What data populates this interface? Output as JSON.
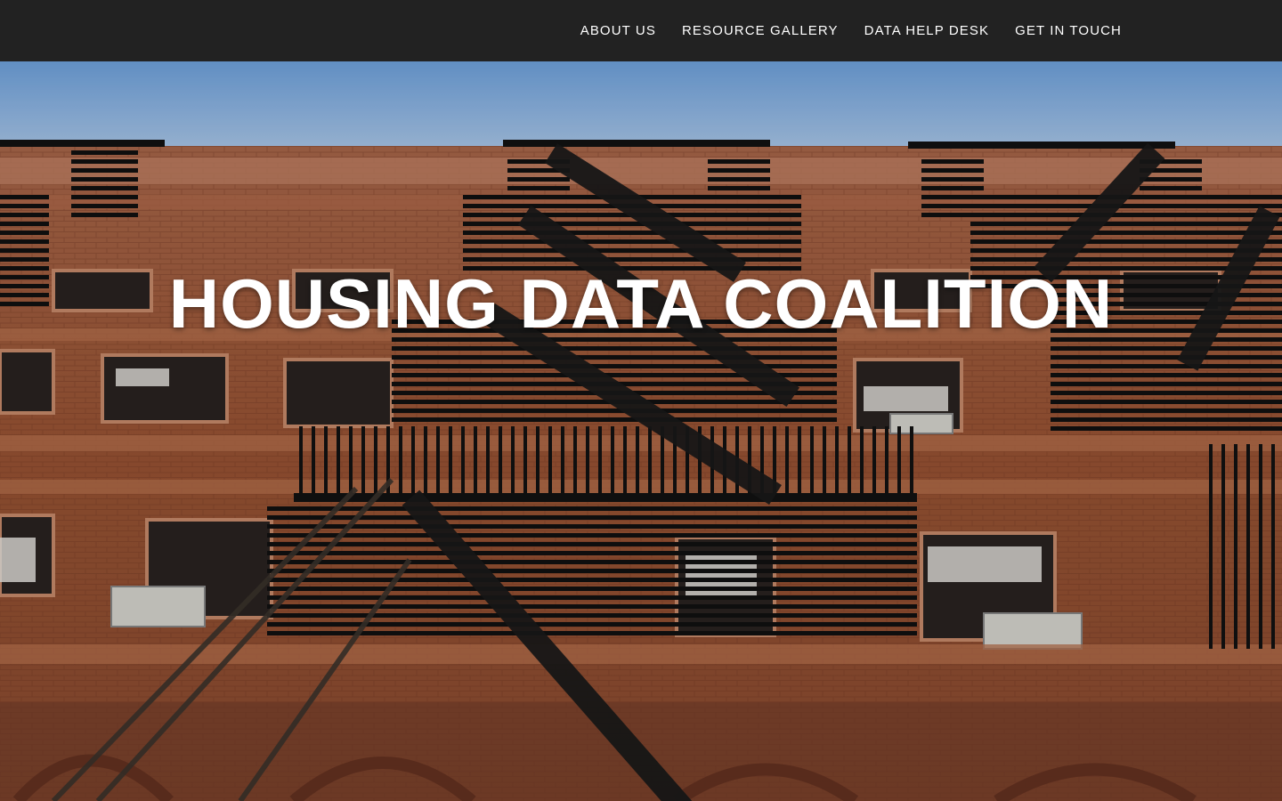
{
  "nav": {
    "items": [
      {
        "label": "ABOUT US"
      },
      {
        "label": "RESOURCE GALLERY"
      },
      {
        "label": "DATA HELP DESK"
      },
      {
        "label": "GET IN TOUCH"
      }
    ]
  },
  "hero": {
    "title": "HOUSING DATA COALITION",
    "image": "apartment-building-fire-escapes-photo"
  },
  "colors": {
    "topbar": "#222222",
    "text": "#ffffff",
    "sky": "#7fb0e6",
    "brick": "#9a5636",
    "iron": "#141414"
  }
}
